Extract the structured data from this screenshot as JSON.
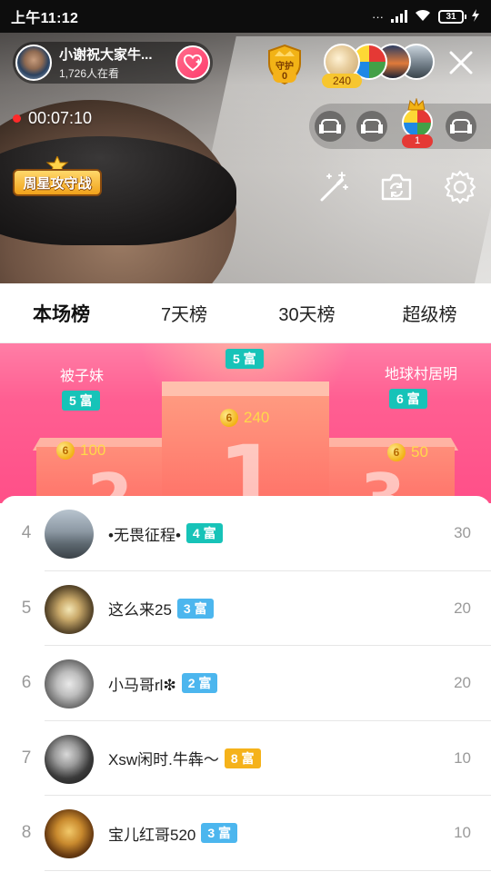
{
  "status_bar": {
    "time": "上午11:12",
    "battery": "31"
  },
  "live": {
    "host_name": "小谢祝大家牛...",
    "viewer_count": "1,726人在看",
    "guard_label": "守护",
    "guard_count": "0",
    "viewer_score": "240",
    "elapsed": "00:07:10",
    "seat_count": "1",
    "weekly_badge": "周星攻守战"
  },
  "tabs": [
    {
      "label": "本场榜",
      "active": true
    },
    {
      "label": "7天榜",
      "active": false
    },
    {
      "label": "30天榜",
      "active": false
    },
    {
      "label": "超级榜",
      "active": false
    }
  ],
  "podium": {
    "first": {
      "name": "",
      "rich_level": "5 富",
      "score": "240"
    },
    "second": {
      "name": "被子妹",
      "rich_level": "5 富",
      "score": "100"
    },
    "third": {
      "name": "地球村居明",
      "rich_level": "6 富",
      "score": "50"
    },
    "coin_symbol": "6",
    "rank_digits": [
      "1",
      "2",
      "3"
    ]
  },
  "ranking": [
    {
      "rank": "4",
      "name": "•无畏征程•",
      "level": "4 富",
      "level_color": "#17c3b8",
      "score": "30"
    },
    {
      "rank": "5",
      "name": "这么来25",
      "level": "3 富",
      "level_color": "#4cb6ee",
      "score": "20"
    },
    {
      "rank": "6",
      "name": "小马哥rl❇",
      "level": "2 富",
      "level_color": "#4cb6ee",
      "score": "20"
    },
    {
      "rank": "7",
      "name": "Xsw闲时.牛犇～",
      "level": "8 富",
      "level_color": "#f5b21a",
      "score": "10"
    },
    {
      "rank": "8",
      "name": "宝儿红哥520",
      "level": "3 富",
      "level_color": "#4cb6ee",
      "score": "10"
    }
  ],
  "icons": {
    "close": "close-icon",
    "follow": "heart-plus-icon",
    "beauty": "magic-wand-icon",
    "camera": "camera-switch-icon",
    "settings": "gear-icon",
    "seat": "sofa-icon"
  }
}
